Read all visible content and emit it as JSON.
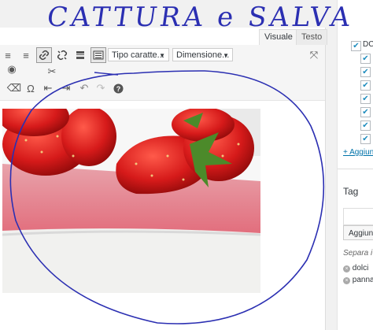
{
  "annotation": {
    "text": "CATTURA e SALVA"
  },
  "editor": {
    "tabs": [
      {
        "label": "Visuale",
        "active": true
      },
      {
        "label": "Testo",
        "active": false
      }
    ],
    "toolbar": {
      "font_family": "Tipo caratte...",
      "font_size": "Dimensione..."
    },
    "icons": [
      "align-left-icon",
      "align-right-icon",
      "link-icon",
      "unlink-icon",
      "read-more-icon",
      "toolbar-toggle-icon",
      "fullscreen-icon",
      "paste-text-icon",
      "clear-formatting-icon",
      "special-character-icon",
      "outdent-icon",
      "indent-icon",
      "undo-icon",
      "redo-icon",
      "help-icon",
      "eye-icon",
      "scissors-icon"
    ]
  },
  "sidebar": {
    "categories": [
      {
        "label": "DC",
        "checked": true
      }
    ],
    "checkbox_rows": 7,
    "add_category_link": "+ Aggiun",
    "tags_title": "Tag",
    "add_tag_button": "Aggiun",
    "separate_hint": "Separa i t",
    "tags": [
      "dolci",
      "panna"
    ]
  },
  "colors": {
    "accent": "#0073aa",
    "annotation_ink": "#2b2fb2"
  }
}
